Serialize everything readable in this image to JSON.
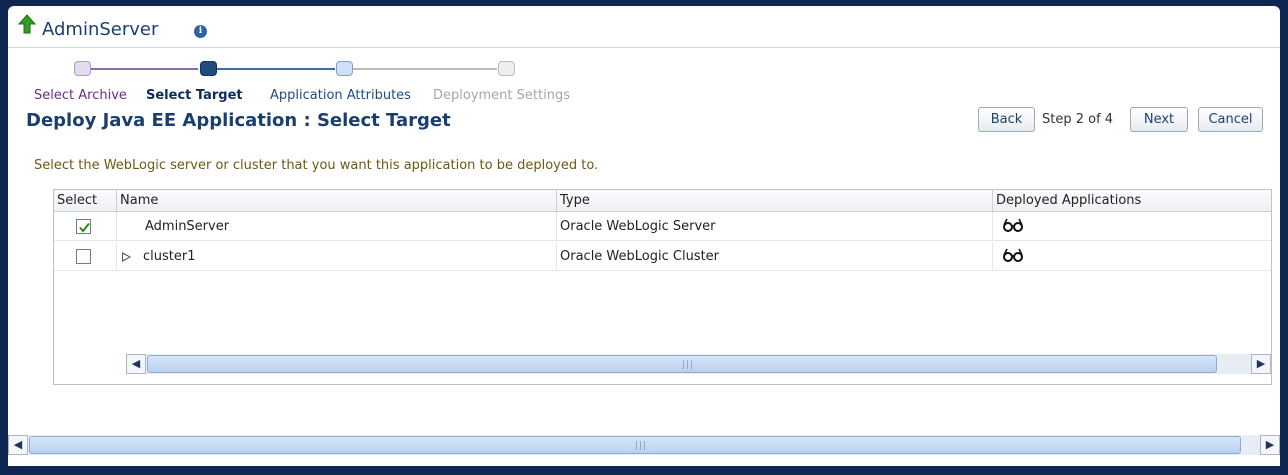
{
  "header": {
    "server_name": "AdminServer",
    "up_icon": "green-up-arrow-icon",
    "info_icon": "info-icon"
  },
  "train": {
    "stops": [
      {
        "label": "Select Archive",
        "state": "visited"
      },
      {
        "label": "Select Target",
        "state": "current"
      },
      {
        "label": "Application Attributes",
        "state": "next"
      },
      {
        "label": "Deployment Settings",
        "state": "disabled"
      }
    ]
  },
  "page": {
    "title": "Deploy Java EE Application : Select Target",
    "instruction": "Select the WebLogic server or cluster that you want this application to be deployed to."
  },
  "nav": {
    "back": "Back",
    "step": "Step 2 of 4",
    "next": "Next",
    "cancel": "Cancel"
  },
  "table": {
    "columns": [
      "Select",
      "Name",
      "Type",
      "Deployed Applications"
    ],
    "rows": [
      {
        "checked": true,
        "name": "AdminServer",
        "type": "Oracle WebLogic Server",
        "expandable": false,
        "deployed_icon": "glasses-icon"
      },
      {
        "checked": false,
        "name": "cluster1",
        "type": "Oracle WebLogic Cluster",
        "expandable": true,
        "deployed_icon": "glasses-icon"
      }
    ]
  },
  "colors": {
    "background": "#0f2650",
    "title": "#1a3f6e",
    "instruction": "#6a5a12",
    "visited": "#6b2c8a"
  }
}
